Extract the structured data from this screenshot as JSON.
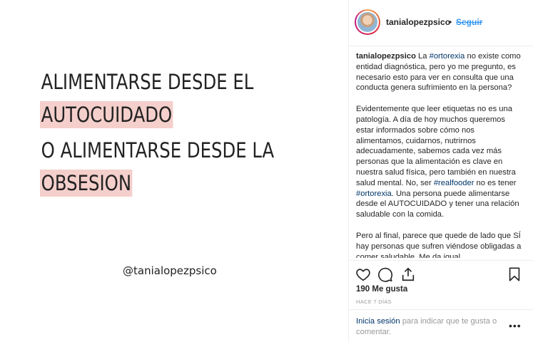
{
  "post_image": {
    "line1": "ALIMENTARSE DESDE EL",
    "line2": "AUTOCUIDADO",
    "line3": "O ALIMENTARSE DESDE LA",
    "line4": "OBSESION",
    "handle": "@tanialopezpsico",
    "highlight_color": "#f4cfcb"
  },
  "header": {
    "username": "tanialopezpsico",
    "separator": "•",
    "follow_label": "Seguir"
  },
  "caption": {
    "username": "tanialopezpsico",
    "p1_a": "La",
    "p1_tag": "#ortorexia",
    "p1_b": "no existe como entidad diagnóstica, pero yo me pregunto, es necesario esto para ver en consulta que una conducta genera sufrimiento en la persona?",
    "p2_a": "Evidentemente que leer etiquetas no es una patología. A día de hoy muchos queremos estar informados sobre cómo nos alimentamos, cuidarnos, nutrirnos adecuadamente, sabemos cada vez más personas que la alimentación es clave en nuestra salud física, pero también en nuestra salud mental. No, ser",
    "p2_tag1": "#realfooder",
    "p2_b": "no es tener",
    "p2_tag2": "#ortorexia",
    "p2_c": ". Una persona puede alimentarse desde el AUTOCUIDADO y tener una relación saludable con la comida.",
    "p3": "Pero al final, parece que quede de lado que SÍ hay personas que sufren viéndose obligadas a comer saludable. Me da igual"
  },
  "actions": {
    "like_icon": "heart-icon",
    "comment_icon": "comment-icon",
    "share_icon": "share-icon",
    "save_icon": "bookmark-icon"
  },
  "likes": "190 Me gusta",
  "time": "HACE 7 DÍAS",
  "login": {
    "link": "Inicia sesión",
    "rest": "para indicar que te gusta o comentar.",
    "more": "•••"
  },
  "colors": {
    "link_blue": "#3897f0",
    "tag_blue": "#003569",
    "muted": "#999999"
  }
}
